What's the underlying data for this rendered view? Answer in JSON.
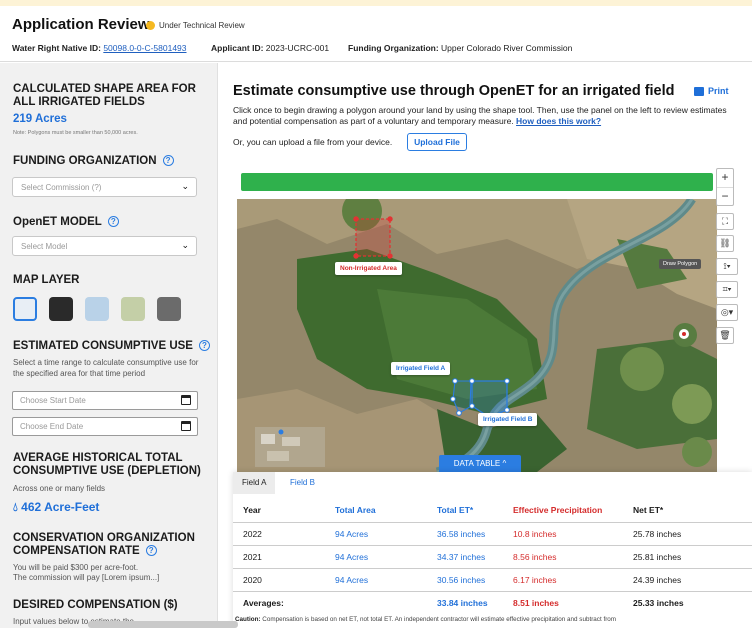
{
  "header": {
    "title": "Application Review",
    "status": "Under Technical Review",
    "water_right_label": "Water Right Native ID:",
    "water_right_value": "50098.0-0-C-5801493",
    "applicant_label": "Applicant ID:",
    "applicant_value": "2023-UCRC-001",
    "funding_label": "Funding Organization:",
    "funding_value": "Upper Colorado River Commission"
  },
  "sidebar": {
    "area_heading": "CALCULATED SHAPE AREA FOR ALL IRRIGATED FIELDS",
    "area_value": "219 Acres",
    "area_note": "Note: Polygons must be smaller than 50,000 acres.",
    "funding_heading": "FUNDING ORGANIZATION",
    "funding_placeholder": "Select Commission (?)",
    "openet_heading": "OpenET MODEL",
    "model_placeholder": "Select Model",
    "map_layer_heading": "MAP LAYER",
    "ecu_heading": "ESTIMATED CONSUMPTIVE USE",
    "ecu_text": "Select a time range to calculate consumptive use for the specified area for that time period",
    "start_date_placeholder": "Choose Start Date",
    "end_date_placeholder": "Choose End Date",
    "avg_heading": "AVERAGE HISTORICAL TOTAL CONSUMPTIVE USE (DEPLETION)",
    "avg_sub": "Across one or many fields",
    "avg_value": "462 Acre-Feet",
    "rate_heading": "CONSERVATION ORGANIZATION COMPENSATION RATE",
    "rate_line1": "You will be paid $300 per acre-foot.",
    "rate_line2": "The commission will pay [Lorem ipsum...]",
    "desired_heading": "DESIRED COMPENSATION ($)",
    "desired_text": "Input values below to estimate the"
  },
  "main": {
    "title": "Estimate consumptive use through OpenET for an irrigated field",
    "print_label": "Print",
    "instructions": "Click once to begin drawing a polygon around your land by using the shape tool. Then, use the panel on the left to review estimates and potential compensation as part of a voluntary and temporary measure.",
    "how_link": "How does this work?",
    "upload_text": "Or, you can upload a file from your device.",
    "upload_button": "Upload File"
  },
  "map": {
    "label_non_irrigated": "Non-Irrigated Area",
    "label_field_a": "Irrigated Field A",
    "label_field_b": "Irrigated Field B",
    "draw_polygon_tooltip": "Draw Polygon",
    "data_table_button": "DATA TABLE  ^",
    "zoom_in": "+",
    "zoom_out": "−"
  },
  "table": {
    "tabs": [
      "Field A",
      "Field B"
    ],
    "headers": [
      "Year",
      "Total Area",
      "Total ET*",
      "Effective Precipitation",
      "Net ET*"
    ],
    "rows": [
      [
        "2022",
        "94 Acres",
        "36.58 inches",
        "10.8 inches",
        "25.78 inches"
      ],
      [
        "2021",
        "94 Acres",
        "34.37 inches",
        "8.56 inches",
        "25.81 inches"
      ],
      [
        "2020",
        "94 Acres",
        "30.56 inches",
        "6.17 inches",
        "24.39 inches"
      ]
    ],
    "averages": [
      "Averages:",
      "",
      "33.84 inches",
      "8.51 inches",
      "25.33 inches"
    ]
  },
  "caution": {
    "label": "Caution:",
    "text": "Compensation is based on net ET, not total ET. An independent contractor will estimate effective precipitation and subtract from"
  },
  "colors": {
    "accent": "#2b7de1",
    "status_dot": "#f5b921",
    "progress_green": "#2fb14c",
    "red": "#d42b2b"
  }
}
